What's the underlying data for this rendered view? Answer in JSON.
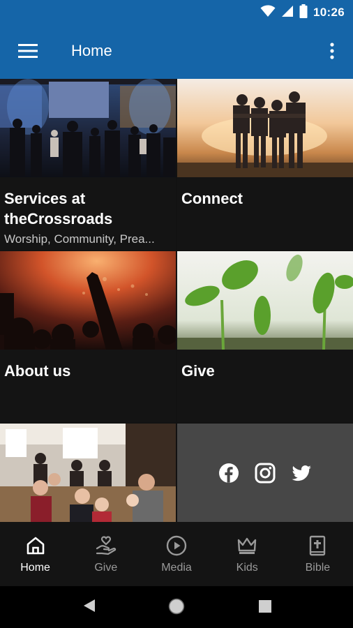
{
  "status_bar": {
    "time": "10:26"
  },
  "app_bar": {
    "title": "Home"
  },
  "tiles": [
    {
      "title": "Services at theCrossroads",
      "title_line1": "Services at",
      "title_line2": "theCrossroads",
      "subtitle": "Worship, Community, Prea..."
    },
    {
      "title": "Connect"
    },
    {
      "title": "About us"
    },
    {
      "title": "Give"
    }
  ],
  "social": [
    "facebook-icon",
    "instagram-icon",
    "twitter-icon"
  ],
  "bottom_nav": [
    {
      "label": "Home",
      "icon": "home-icon",
      "active": true
    },
    {
      "label": "Give",
      "icon": "give-hand-heart-icon",
      "active": false
    },
    {
      "label": "Media",
      "icon": "play-circle-icon",
      "active": false
    },
    {
      "label": "Kids",
      "icon": "crown-icon",
      "active": false
    },
    {
      "label": "Bible",
      "icon": "bible-icon",
      "active": false
    }
  ],
  "colors": {
    "primary": "#1565a8",
    "background": "#121212",
    "tile_background": "#141414",
    "social_tile": "#474747"
  }
}
